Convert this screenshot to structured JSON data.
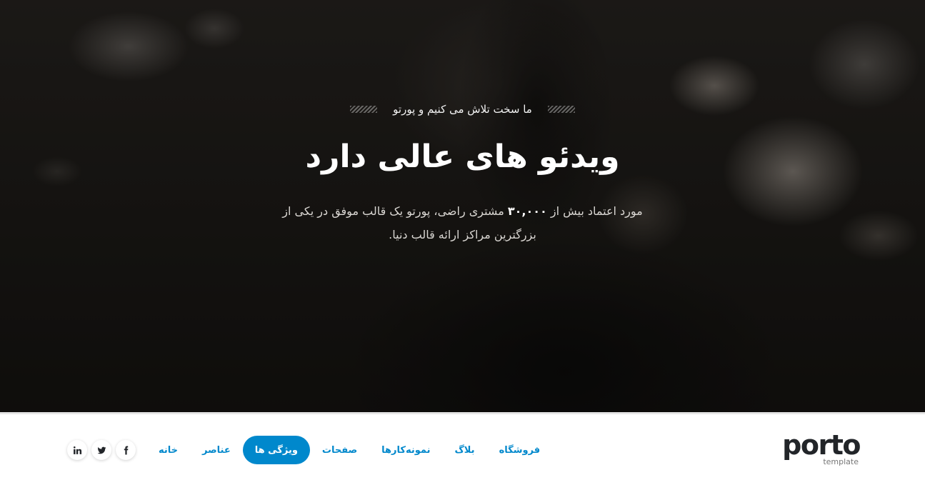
{
  "hero": {
    "eyebrow": "ما سخت تلاش می کنیم و پورتو",
    "title": "ویدئو های عالی دارد",
    "description_before": "مورد اعتماد بیش از ",
    "description_strong": "۳۰,۰۰۰",
    "description_after": " مشتری راضی، پورتو یک قالب موفق در یکی از بزرگترین مراکز ارائه قالب دنیا."
  },
  "header": {
    "logo_word": "porto",
    "logo_sub": "template",
    "nav": [
      {
        "label": "خانه",
        "active": false
      },
      {
        "label": "عناصر",
        "active": false
      },
      {
        "label": "ویژگی ها",
        "active": true
      },
      {
        "label": "صفحات",
        "active": false
      },
      {
        "label": "نمونه‌کارها",
        "active": false
      },
      {
        "label": "بلاگ",
        "active": false
      },
      {
        "label": "فروشگاه",
        "active": false
      }
    ],
    "social": [
      {
        "icon": "facebook-icon"
      },
      {
        "icon": "twitter-icon"
      },
      {
        "icon": "linkedin-icon"
      }
    ]
  },
  "colors": {
    "accent": "#0088cc",
    "dark": "#222529"
  }
}
